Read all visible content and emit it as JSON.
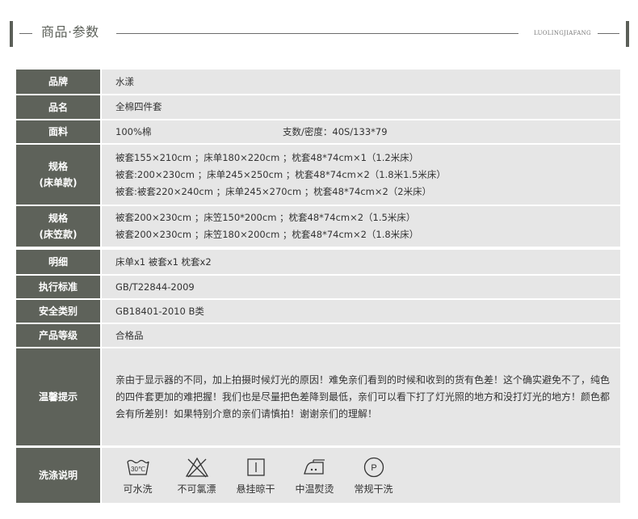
{
  "header": {
    "title": "商品·参数",
    "subtitle": "LUOLINGJIAFANG"
  },
  "spec": {
    "brand": {
      "label": "品牌",
      "value": "水漾"
    },
    "name": {
      "label": "品名",
      "value": "全棉四件套"
    },
    "fabric": {
      "label": "面料",
      "value": "100%棉",
      "value2": "支数/密度：40S/133*79"
    },
    "size_flat": {
      "label1": "规格",
      "label2": "(床单款)",
      "lines": [
        "被套155×210cm ；床单180×220cm ；枕套48*74cm×1（1.2米床）",
        "被套:200×230cm ；床单245×250cm ；枕套48*74cm×2（1.8米1.5米床）",
        "被套:被套220×240cm ；床单245×270cm ；枕套48*74cm×2（2米床）"
      ]
    },
    "size_fitted": {
      "label1": "规格",
      "label2": "(床笠款)",
      "lines": [
        "被套200×230cm ；床笠150*200cm ；枕套48*74cm×2（1.5米床）",
        "被套200×230cm ；床笠180×200cm ；枕套48*74cm×2（1.8米床）"
      ]
    },
    "details": {
      "label": "明细",
      "value": "床单x1 被套x1 枕套x2"
    },
    "standard": {
      "label": "执行标准",
      "value": "GB/T22844-2009"
    },
    "safety": {
      "label": "安全类别",
      "value": "GB18401-2010 B类"
    },
    "grade": {
      "label": "产品等级",
      "value": "合格品"
    },
    "tip": {
      "label": "温馨提示",
      "text": "亲由于显示器的不同，加上拍摄时候灯光的原因！难免亲们看到的时候和收到的货有色差！这个确实避免不了，纯色的四件套更加的难把握！我们也是尽量把色差降到最低，亲们可以看下打了灯光照的地方和没打灯光的地方！颜色都会有所差别！如果特别介意的亲们请慎拍！谢谢亲们的理解！"
    },
    "washing": {
      "label": "洗涤说明",
      "items": [
        {
          "icon": "wash-30-icon",
          "label": "可水洗",
          "temp": "30℃"
        },
        {
          "icon": "no-bleach-icon",
          "label": "不可氯漂"
        },
        {
          "icon": "hang-dry-icon",
          "label": "悬挂晾干"
        },
        {
          "icon": "iron-medium-icon",
          "label": "中温熨烫"
        },
        {
          "icon": "dry-clean-p-icon",
          "label": "常规干洗",
          "glyph": "P"
        }
      ]
    }
  },
  "colors": {
    "label_bg": "#5e625a",
    "value_bg": "#e6e6e6",
    "accent": "#5b5f58"
  }
}
